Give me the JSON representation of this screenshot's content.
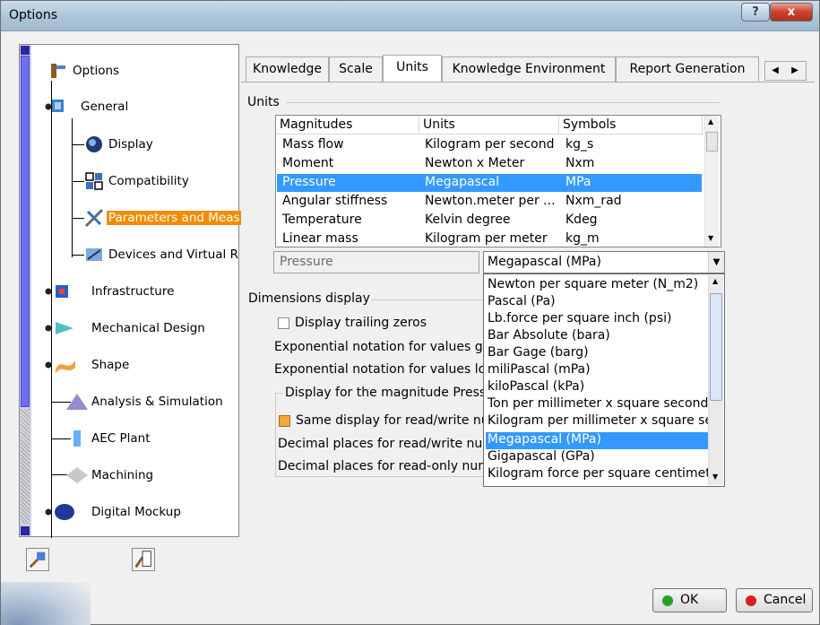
{
  "window": {
    "title": "Options",
    "help_glyph": "?",
    "close_glyph": "x"
  },
  "tree": {
    "root": "Options",
    "items": [
      {
        "label": "General"
      },
      {
        "label": "Display"
      },
      {
        "label": "Compatibility"
      },
      {
        "label": "Parameters and Meas"
      },
      {
        "label": "Devices and Virtual R"
      },
      {
        "label": "Infrastructure"
      },
      {
        "label": "Mechanical Design"
      },
      {
        "label": "Shape"
      },
      {
        "label": "Analysis & Simulation"
      },
      {
        "label": "AEC Plant"
      },
      {
        "label": "Machining"
      },
      {
        "label": "Digital Mockup"
      }
    ]
  },
  "tabs": [
    {
      "label": "Knowledge"
    },
    {
      "label": "Scale"
    },
    {
      "label": "Units"
    },
    {
      "label": "Knowledge Environment"
    },
    {
      "label": "Report Generation"
    }
  ],
  "units_section": {
    "title": "Units",
    "headers": [
      "Magnitudes",
      "Units",
      "Symbols"
    ],
    "rows": [
      [
        "Mass flow",
        "Kilogram per second",
        "kg_s"
      ],
      [
        "Moment",
        "Newton x Meter",
        "Nxm"
      ],
      [
        "Pressure",
        "Megapascal",
        "MPa"
      ],
      [
        "Angular stiffness",
        "Newton.meter per ...",
        "Nxm_rad"
      ],
      [
        "Temperature",
        "Kelvin degree",
        "Kdeg"
      ],
      [
        "Linear mass",
        "Kilogram per meter",
        "kg_m"
      ]
    ],
    "selected_magnitude": "Pressure",
    "selected_unit": "Megapascal (MPa)"
  },
  "dropdown_options": [
    "Newton per square meter (N_m2)",
    "Pascal (Pa)",
    "Lb.force per square inch (psi)",
    "Bar Absolute (bara)",
    "Bar Gage (barg)",
    "miliPascal (mPa)",
    "kiloPascal (kPa)",
    "Ton per millimeter x square second",
    "Kilogram per millimeter x square se",
    "Megapascal (MPa)",
    "Gigapascal (GPa)",
    "Kilogram force per square centimet"
  ],
  "dimensions": {
    "title": "Dimensions display",
    "trailing_zeros": "Display trailing zeros",
    "exp_greater": "Exponential notation for values gre",
    "exp_lower": "Exponential notation for values lov",
    "magnitude_group": "Display for the magnitude Pressu",
    "same_display": "Same display for read/write nu",
    "decimal_rw": "Decimal places for read/write num",
    "decimal_ro": "Decimal places for read-only num"
  },
  "buttons": {
    "ok": "OK",
    "cancel": "Cancel"
  },
  "colors": {
    "selection": "#3399ff",
    "tree_selection": "#f28c00"
  }
}
